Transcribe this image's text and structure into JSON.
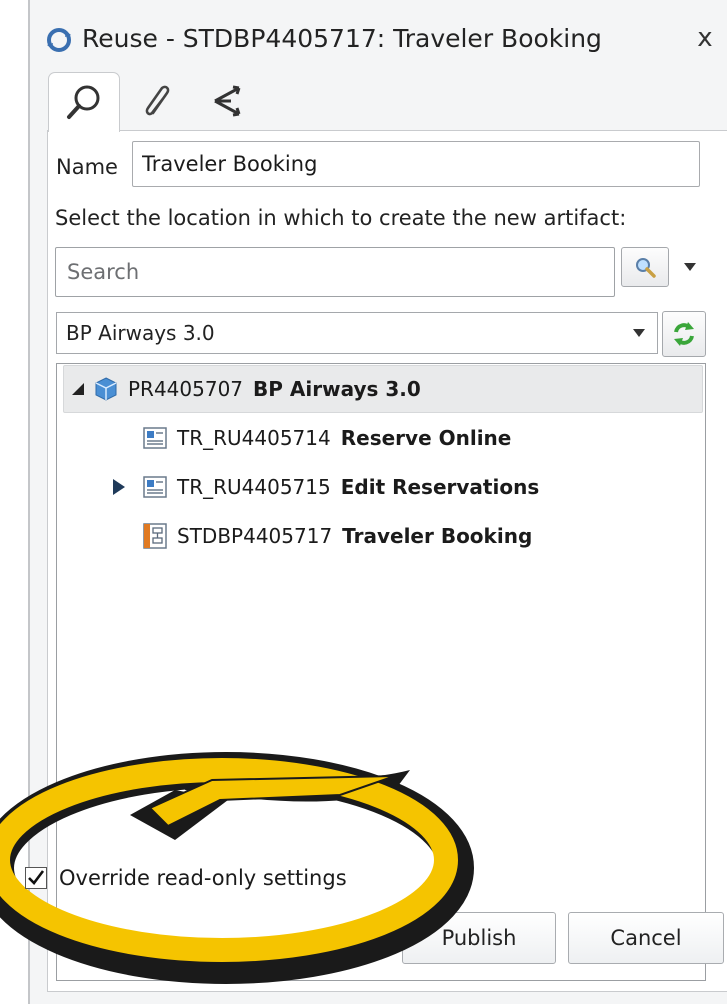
{
  "window": {
    "title": "Reuse - STDBP4405717: Traveler Booking",
    "close_label": "x"
  },
  "tabs": [
    {
      "icon": "search-icon",
      "active": true
    },
    {
      "icon": "paperclip-icon",
      "active": false
    },
    {
      "icon": "share-icon",
      "active": false
    }
  ],
  "form": {
    "name_label": "Name",
    "name_value": "Traveler Booking",
    "instruction": "Select the location in which to create the new artifact:",
    "search_placeholder": "Search",
    "selected_project": "BP Airways 3.0"
  },
  "tree": {
    "root": {
      "id": "PR4405707",
      "name": "BP Airways 3.0",
      "expanded": true,
      "icon": "project-cube-icon"
    },
    "children": [
      {
        "id": "TR_RU4405714",
        "name": "Reserve Online",
        "icon": "textual-requirement-icon",
        "expandable": false
      },
      {
        "id": "TR_RU4405715",
        "name": "Edit Reservations",
        "icon": "textual-requirement-icon",
        "expandable": true
      },
      {
        "id": "STDBP4405717",
        "name": "Traveler Booking",
        "icon": "business-process-icon",
        "expandable": false
      }
    ]
  },
  "options": {
    "override_label": "Override read-only settings",
    "override_checked": true
  },
  "buttons": {
    "publish": "Publish",
    "cancel": "Cancel"
  },
  "colors": {
    "highlight_ring": "#f5c400",
    "refresh_green": "#3aa63a",
    "cube_blue": "#4a8fd4"
  }
}
